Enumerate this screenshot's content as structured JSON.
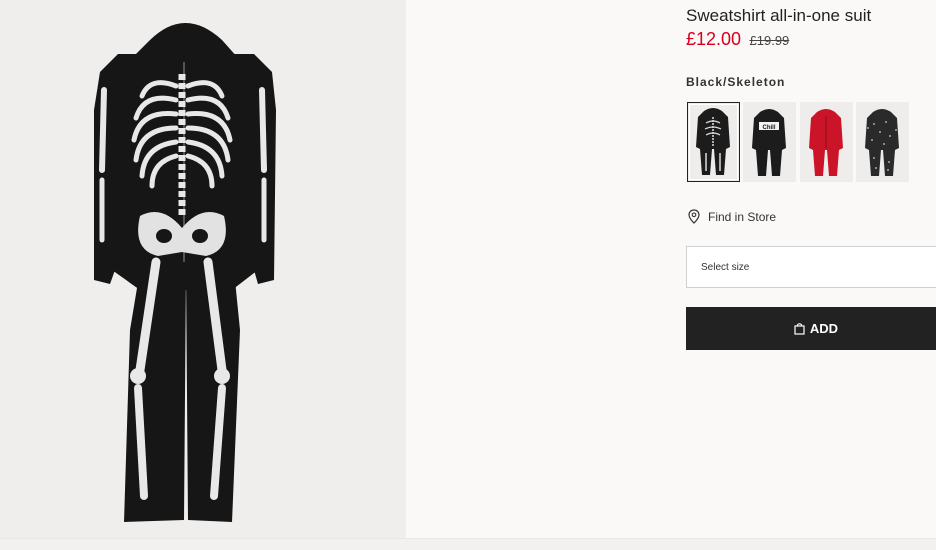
{
  "product": {
    "title": "Sweatshirt all-in-one suit",
    "price_sale": "£12.00",
    "price_original": "£19.99"
  },
  "colors": {
    "selected_name": "Black/Skeleton",
    "swatches": [
      {
        "name": "Black/Skeleton",
        "selected": true,
        "fill": "#1c1c1c"
      },
      {
        "name": "Black print",
        "selected": false,
        "fill": "#1c1c1c"
      },
      {
        "name": "Red",
        "selected": false,
        "fill": "#cc1428"
      },
      {
        "name": "Dark grey print",
        "selected": false,
        "fill": "#2a2a2a"
      }
    ],
    "swatch_print_text": "Chill"
  },
  "store": {
    "find_in_store_label": "Find in Store",
    "icon": "map-pin-icon"
  },
  "size": {
    "placeholder": "Select size"
  },
  "cart": {
    "add_label": "ADD",
    "icon": "shopping-bag-icon"
  },
  "theme": {
    "sale_price_color": "#d6001c",
    "button_bg": "#222222",
    "page_bg": "#faf9f8"
  }
}
